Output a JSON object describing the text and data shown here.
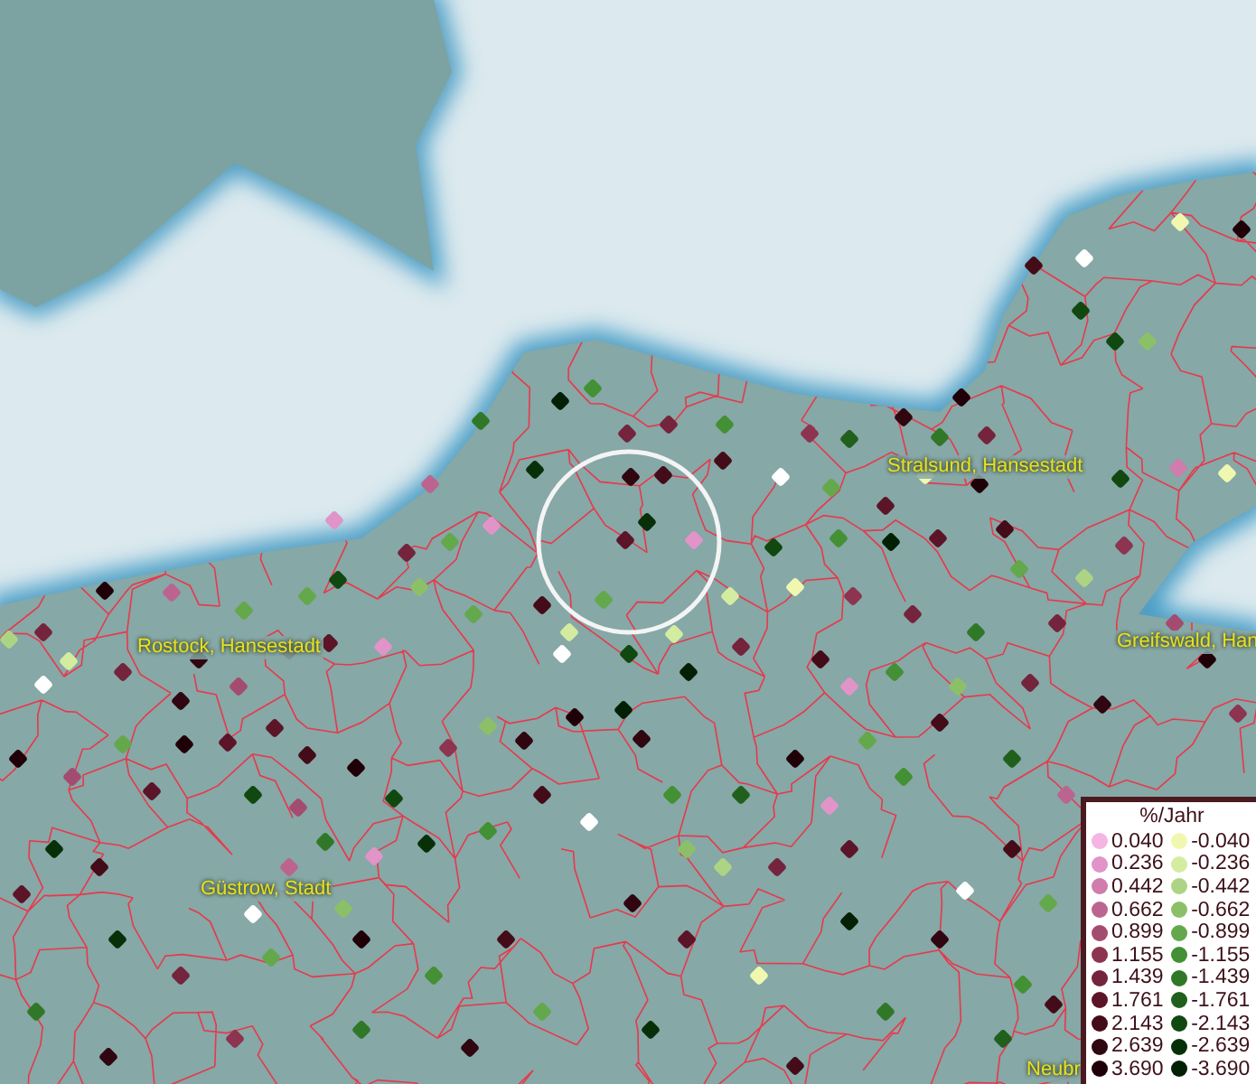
{
  "places": [
    {
      "name": "Stralsund, Hansestadt"
    },
    {
      "name": "Rostock, Hansestadt"
    },
    {
      "name": "Greifswald, Han"
    },
    {
      "name": "Güstrow, Stadt"
    },
    {
      "name": "Neubr"
    }
  ],
  "legend": {
    "title": "%/Jahr",
    "positive": [
      {
        "label": "0.040",
        "color": "#f4b4e4"
      },
      {
        "label": "0.236",
        "color": "#e094c8"
      },
      {
        "label": "0.442",
        "color": "#d07cac"
      },
      {
        "label": "0.662",
        "color": "#bc6490"
      },
      {
        "label": "0.899",
        "color": "#a44c70"
      },
      {
        "label": "1.155",
        "color": "#8c3450"
      },
      {
        "label": "1.439",
        "color": "#74243c"
      },
      {
        "label": "1.761",
        "color": "#5c1428"
      },
      {
        "label": "2.143",
        "color": "#440c18"
      },
      {
        "label": "2.639",
        "color": "#300610"
      },
      {
        "label": "3.690",
        "color": "#200008"
      }
    ],
    "negative": [
      {
        "label": "-0.040",
        "color": "#f0f8b0"
      },
      {
        "label": "-0.236",
        "color": "#d4eca0"
      },
      {
        "label": "-0.442",
        "color": "#acd484"
      },
      {
        "label": "-0.662",
        "color": "#8cc068"
      },
      {
        "label": "-0.899",
        "color": "#64a84c"
      },
      {
        "label": "-1.155",
        "color": "#449034"
      },
      {
        "label": "-1.439",
        "color": "#307828"
      },
      {
        "label": "-1.761",
        "color": "#20601c"
      },
      {
        "label": "-2.143",
        "color": "#104810"
      },
      {
        "label": "-2.639",
        "color": "#083008"
      },
      {
        "label": "-3.690",
        "color": "#042004"
      }
    ]
  }
}
